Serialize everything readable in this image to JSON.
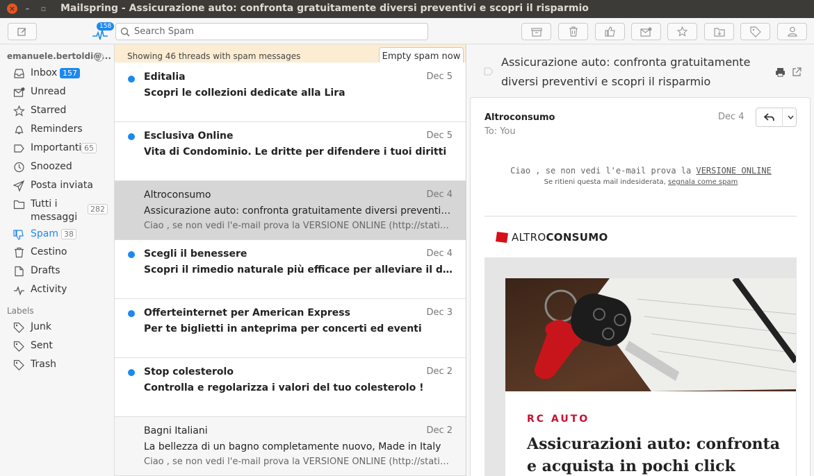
{
  "window": {
    "title": "Mailspring - Assicurazione auto: confronta gratuitamente diversi preventivi e scopri il risparmio"
  },
  "toolbar": {
    "activity_badge": "158",
    "search_placeholder": "Search Spam",
    "buttons": [
      "archive-icon",
      "trash-icon",
      "thumbs-up-icon",
      "mark-unread-icon",
      "star-icon",
      "move-folder-icon",
      "label-icon",
      "contact-icon"
    ]
  },
  "sidebar": {
    "account": "emanuele.bertoldi@...",
    "items": [
      {
        "label": "Inbox",
        "count": "157",
        "icon": "inbox-icon"
      },
      {
        "label": "Unread",
        "count": "",
        "icon": "unread-icon"
      },
      {
        "label": "Starred",
        "count": "",
        "icon": "star-icon"
      },
      {
        "label": "Reminders",
        "count": "",
        "icon": "bell-icon"
      },
      {
        "label": "Importanti",
        "count": "65",
        "icon": "important-icon"
      },
      {
        "label": "Snoozed",
        "count": "",
        "icon": "clock-icon"
      },
      {
        "label": "Posta inviata",
        "count": "",
        "icon": "send-icon"
      },
      {
        "label": "Tutti i messaggi",
        "count": "282",
        "icon": "folder-icon"
      },
      {
        "label": "Spam",
        "count": "38",
        "icon": "spam-icon"
      },
      {
        "label": "Cestino",
        "count": "",
        "icon": "trash-icon"
      },
      {
        "label": "Drafts",
        "count": "",
        "icon": "drafts-icon"
      },
      {
        "label": "Activity",
        "count": "",
        "icon": "activity-icon"
      }
    ],
    "labels_header": "Labels",
    "labels": [
      {
        "label": "Junk"
      },
      {
        "label": "Sent"
      },
      {
        "label": "Trash"
      }
    ]
  },
  "spam_bar": {
    "message": "Showing 46 threads with spam messages",
    "button": "Empty spam now"
  },
  "threads": [
    {
      "sender": "Editalia",
      "date": "Dec 5",
      "subject": "Scopri le collezioni dedicate alla Lira",
      "snippet": "",
      "unread": true
    },
    {
      "sender": "Esclusiva Online",
      "date": "Dec 5",
      "subject": "Vita di Condominio. Le dritte per difendere i tuoi diritti",
      "snippet": "",
      "unread": true
    },
    {
      "sender": "Altroconsumo",
      "date": "Dec 4",
      "subject": "Assicurazione auto: confronta gratuitamente diversi preventivi e scopri il risparmio",
      "snippet": "Ciao , se non vedi l'e-mail prova la VERSIONE ONLINE (http://static.ketchup...",
      "unread": false
    },
    {
      "sender": "Scegli il benessere",
      "date": "Dec 4",
      "subject": "Scopri il rimedio naturale più efficace per alleviare il dolore alle articolazioni",
      "snippet": "",
      "unread": true
    },
    {
      "sender": "Offerteinternet per American Express",
      "date": "Dec 3",
      "subject": "Per te biglietti in anteprima per concerti ed eventi",
      "snippet": "",
      "unread": true
    },
    {
      "sender": "Stop colesterolo",
      "date": "Dec 2",
      "subject": "Controlla e regolarizza i valori del tuo colesterolo !",
      "snippet": "",
      "unread": true
    },
    {
      "sender": "Bagni Italiani",
      "date": "Dec 2",
      "subject": "La bellezza di un bagno completamente nuovo, Made in Italy",
      "snippet": "Ciao , se non vedi l'e-mail prova la VERSIONE ONLINE (http://static.ketchup...",
      "unread": false
    }
  ],
  "reader": {
    "subject": "Assicurazione auto: confronta gratuitamente diversi preventivi e scopri il risparmio",
    "from": "Altroconsumo",
    "to": "To: You",
    "date": "Dec 4",
    "body_line1_prefix": "Ciao , se non vedi l'e-mail prova la ",
    "body_line1_link": "VERSIONE ONLINE",
    "body_line2_prefix": "Se ritieni questa mail indesiderata, ",
    "body_line2_link": "segnala come spam",
    "logo_light": "ALTRO",
    "logo_bold": "CONSUMO",
    "section": "RC AUTO",
    "headline": "Assicurazioni auto: confronta e acquista in pochi click"
  },
  "colors": {
    "accent": "#1b89ef",
    "spam_bar_bg": "#fcecd2",
    "brand_red": "#c8102e",
    "titlebar": "#3c3b37"
  }
}
